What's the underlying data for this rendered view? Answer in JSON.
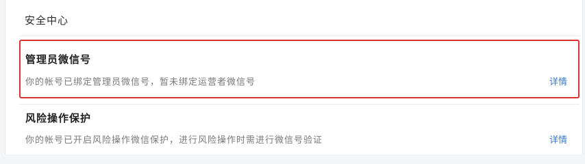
{
  "page": {
    "title": "安全中心"
  },
  "sections": [
    {
      "title": "管理员微信号",
      "description": "你的帐号已绑定管理员微信号，暂未绑定运营者微信号",
      "link_label": "详情"
    },
    {
      "title": "风险操作保护",
      "description": "你的帐号已开启风险操作微信保护，进行风险操作时需进行微信号验证",
      "link_label": "详情"
    }
  ],
  "colors": {
    "highlight_border": "#d9312b",
    "link": "#3a78c9"
  }
}
